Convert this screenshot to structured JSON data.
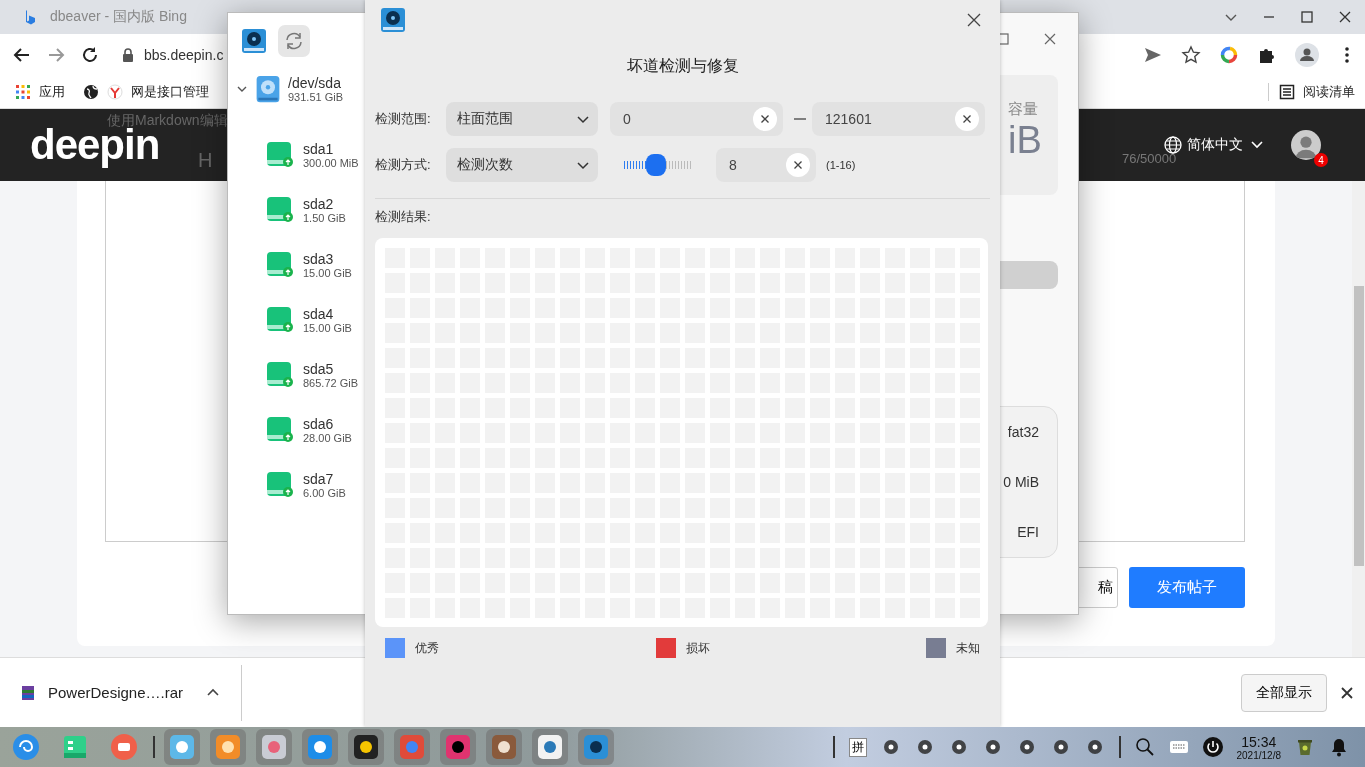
{
  "browser": {
    "tab": {
      "title": "dbeaver - 国内版 Bing"
    },
    "url": "bbs.deepin.c",
    "bookmarks": [
      "应用",
      "网是接口管理"
    ],
    "reading_list": "阅读清单"
  },
  "page": {
    "logo": "deepin",
    "editor_hint": "使用Markdown编辑",
    "heading_tool": "H",
    "language": "简体中文",
    "notification_count": "4",
    "char_count": "76/50000",
    "draft_button": "稿",
    "publish_button": "发布帖子"
  },
  "downloads": {
    "file": "PowerDesigne….rar",
    "show_all": "全部显示"
  },
  "partition_manager": {
    "disk": {
      "name": "/dev/sda",
      "size": "931.51 GiB",
      "expanded": true,
      "partitions": [
        {
          "name": "sda1",
          "size": "300.00 MiB"
        },
        {
          "name": "sda2",
          "size": "1.50 GiB"
        },
        {
          "name": "sda3",
          "size": "15.00 GiB"
        },
        {
          "name": "sda4",
          "size": "15.00 GiB"
        },
        {
          "name": "sda5",
          "size": "865.72 GiB"
        },
        {
          "name": "sda6",
          "size": "28.00 GiB"
        },
        {
          "name": "sda7",
          "size": "6.00 GiB"
        }
      ]
    },
    "capacity_label": "容量",
    "capacity_value": "iB",
    "info": [
      "fat32",
      "0 MiB",
      "EFI"
    ]
  },
  "dialog": {
    "title": "坏道检测与修复",
    "range_label": "检测范围:",
    "range_mode": "柱面范围",
    "range_start": "0",
    "range_end": "121601",
    "method_label": "检测方式:",
    "method_mode": "检测次数",
    "times": {
      "level": 0.47
    },
    "times_value": "8",
    "times_hint": "(1-16)",
    "result_label": "检测结果:",
    "legend": [
      {
        "label": "优秀",
        "color": "#5b94f9"
      },
      {
        "label": "损坏",
        "color": "#e23b3b"
      },
      {
        "label": "未知",
        "color": "#787d92"
      }
    ]
  },
  "taskbar": {
    "input_method": "拼",
    "time": "15:34",
    "date": "2021/12/8"
  }
}
